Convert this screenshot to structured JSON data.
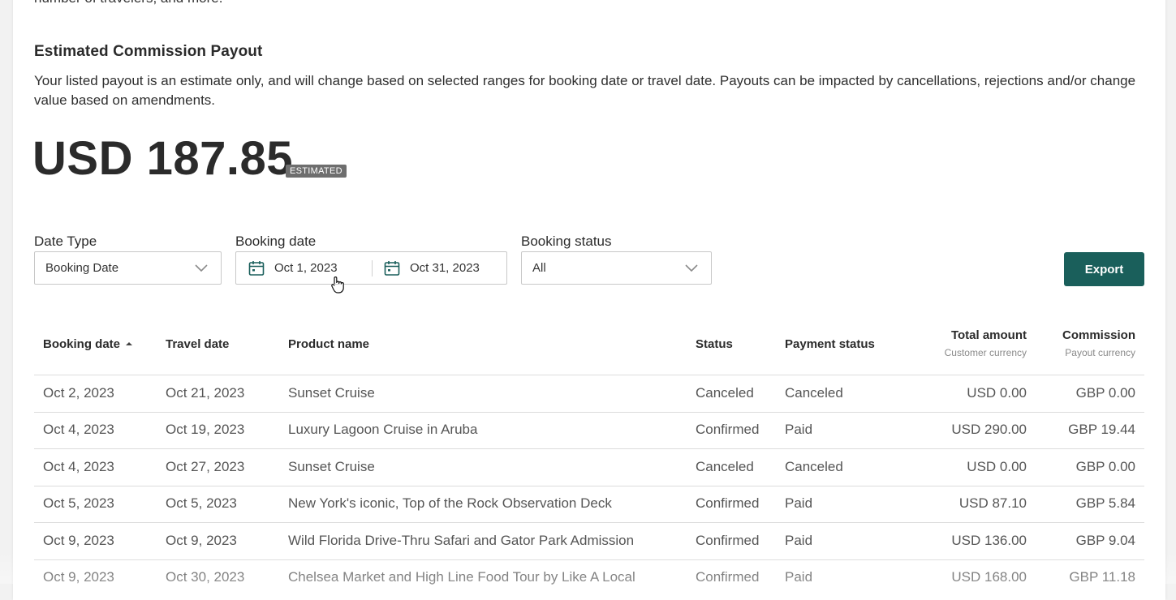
{
  "intro_cutoff": "number of travelers, and more.",
  "payout": {
    "title": "Estimated Commission Payout",
    "description": "Your listed payout is an estimate only, and will change based on selected ranges for booking date or travel date. Payouts can be impacted by cancellations, rejections and/or change value based on amendments.",
    "amount": "USD 187.85",
    "badge": "ESTIMATED"
  },
  "filters": {
    "date_type": {
      "label": "Date Type",
      "value": "Booking Date"
    },
    "booking_date": {
      "label": "Booking date",
      "from": "Oct 1, 2023",
      "to": "Oct 31, 2023"
    },
    "booking_status": {
      "label": "Booking status",
      "value": "All"
    },
    "export_label": "Export"
  },
  "table": {
    "headers": {
      "booking_date": "Booking date",
      "travel_date": "Travel date",
      "product_name": "Product name",
      "status": "Status",
      "payment_status": "Payment status",
      "total_amount": "Total amount",
      "total_amount_sub": "Customer currency",
      "commission": "Commission",
      "commission_sub": "Payout currency"
    },
    "rows": [
      {
        "booking": "Oct 2, 2023",
        "travel": "Oct 21, 2023",
        "product": "Sunset Cruise",
        "status": "Canceled",
        "payment": "Canceled",
        "total": "USD 0.00",
        "commission": "GBP 0.00"
      },
      {
        "booking": "Oct 4, 2023",
        "travel": "Oct 19, 2023",
        "product": "Luxury Lagoon Cruise in Aruba",
        "status": "Confirmed",
        "payment": "Paid",
        "total": "USD 290.00",
        "commission": "GBP 19.44"
      },
      {
        "booking": "Oct 4, 2023",
        "travel": "Oct 27, 2023",
        "product": "Sunset Cruise",
        "status": "Canceled",
        "payment": "Canceled",
        "total": "USD 0.00",
        "commission": "GBP 0.00"
      },
      {
        "booking": "Oct 5, 2023",
        "travel": "Oct 5, 2023",
        "product": "New York's iconic, Top of the Rock Observation Deck",
        "status": "Confirmed",
        "payment": "Paid",
        "total": "USD 87.10",
        "commission": "GBP 5.84"
      },
      {
        "booking": "Oct 9, 2023",
        "travel": "Oct 9, 2023",
        "product": "Wild Florida Drive-Thru Safari and Gator Park Admission",
        "status": "Confirmed",
        "payment": "Paid",
        "total": "USD 136.00",
        "commission": "GBP 9.04"
      },
      {
        "booking": "Oct 9, 2023",
        "travel": "Oct 30, 2023",
        "product": "Chelsea Market and High Line Food Tour by Like A Local",
        "status": "Confirmed",
        "payment": "Paid",
        "total": "USD 168.00",
        "commission": "GBP 11.18"
      }
    ]
  },
  "colors": {
    "accent": "#1a5f5b",
    "badge": "#6e6e6e"
  }
}
